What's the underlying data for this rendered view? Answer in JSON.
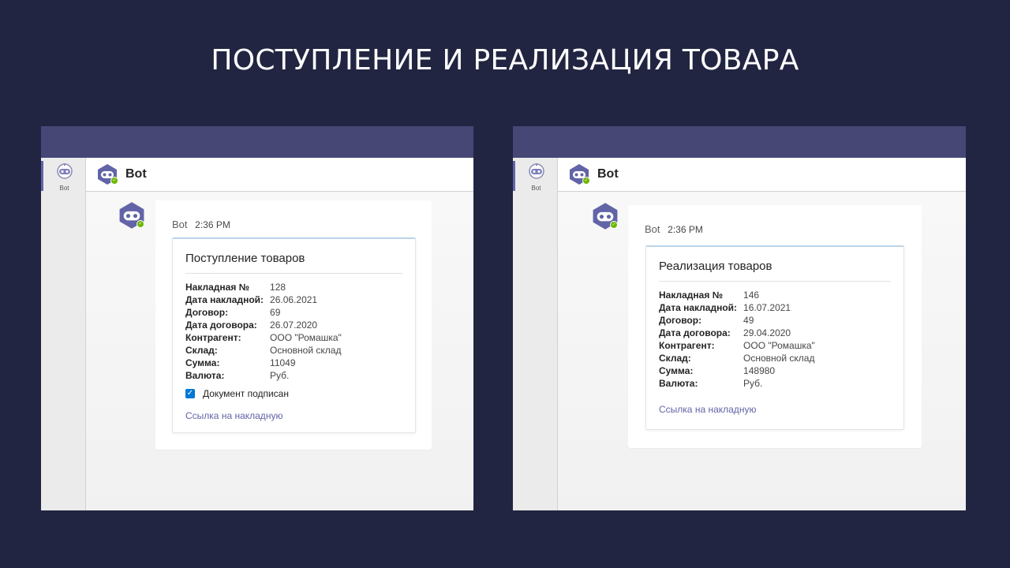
{
  "slide": {
    "title": "ПОСТУПЛЕНИЕ И РЕАЛИЗАЦИЯ ТОВАРА"
  },
  "colors": {
    "background": "#222541",
    "teams_bar": "#464775",
    "accent": "#6264a7",
    "presence": "#6bb700",
    "checkbox": "#0078d4"
  },
  "left_panel": {
    "rail_item_label": "Bot",
    "header_title": "Bot",
    "message": {
      "sender": "Bot",
      "time": "2:36 PM",
      "card": {
        "title": "Поступление товаров",
        "facts": [
          {
            "key": "Накладная №",
            "value": "128"
          },
          {
            "key": "Дата накладной:",
            "value": "26.06.2021"
          },
          {
            "key": "Договор:",
            "value": "69"
          },
          {
            "key": "Дата договора:",
            "value": "26.07.2020"
          },
          {
            "key": "Контрагент:",
            "value": "ООО \"Ромашка\""
          },
          {
            "key": "Склад:",
            "value": "Основной склад"
          },
          {
            "key": "Сумма:",
            "value": "11049"
          },
          {
            "key": "Валюта:",
            "value": "Руб."
          }
        ],
        "checkbox_label": "Документ подписан",
        "checkbox_checked": true,
        "link_label": "Ссылка на накладную"
      }
    }
  },
  "right_panel": {
    "rail_item_label": "Bot",
    "header_title": "Bot",
    "message": {
      "sender": "Bot",
      "time": "2:36 PM",
      "card": {
        "title": "Реализация товаров",
        "facts": [
          {
            "key": "Накладная №",
            "value": "146"
          },
          {
            "key": "Дата накладной:",
            "value": "16.07.2021"
          },
          {
            "key": "Договор:",
            "value": "49"
          },
          {
            "key": "Дата договора:",
            "value": "29.04.2020"
          },
          {
            "key": "Контрагент:",
            "value": "ООО \"Ромашка\""
          },
          {
            "key": "Склад:",
            "value": "Основной склад"
          },
          {
            "key": "Сумма:",
            "value": "148980"
          },
          {
            "key": "Валюта:",
            "value": "Руб."
          }
        ],
        "link_label": "Ссылка на накладную"
      }
    }
  },
  "icons": {
    "rail_item": "bot-icon",
    "header_avatar": "bot-avatar-icon",
    "presence": "available-status-icon",
    "checkbox": "checkmark-icon"
  }
}
